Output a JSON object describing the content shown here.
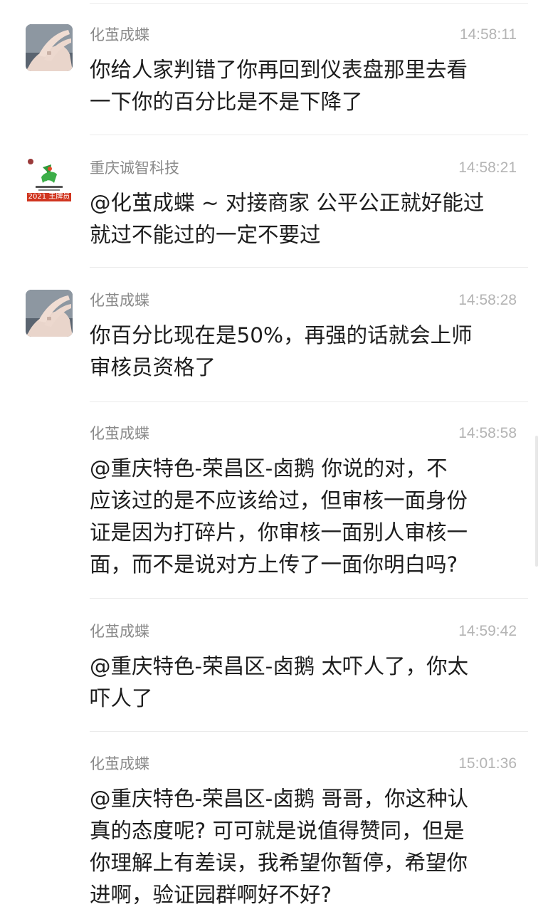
{
  "messages": [
    {
      "sender": "化茧成蝶",
      "time": "14:58:11",
      "text": "你给人家判错了你再回到仪表盘那里去看\n一下你的百分比是不是下降了"
    },
    {
      "sender": "重庆诚智科技",
      "time": "14:58:21",
      "text": "@化茧成蝶 ~ 对接商家 公平公正就好能过\n就过不能过的一定不要过",
      "avatar_badge": "2021 王牌员"
    },
    {
      "sender": "化茧成蝶",
      "time": "14:58:28",
      "text": "你百分比现在是50%，再强的话就会上师\n审核员资格了"
    },
    {
      "sender": "化茧成蝶",
      "time": "14:58:58",
      "text": "@重庆特色-荣昌区-卤鹅 你说的对，不\n应该过的是不应该给过，但审核一面身份\n证是因为打碎片，你审核一面别人审核一\n面，而不是说对方上传了一面你明白吗?"
    },
    {
      "sender": "化茧成蝶",
      "time": "14:59:42",
      "text": "@重庆特色-荣昌区-卤鹅 太吓人了，你太\n吓人了"
    },
    {
      "sender": "化茧成蝶",
      "time": "15:01:36",
      "text": "@重庆特色-荣昌区-卤鹅 哥哥，你这种认\n真的态度呢? 可可就是说值得赞同，但是\n你理解上有差误，我希望你暂停，希望你\n进啊，验证园群啊好不好?"
    }
  ],
  "colors": {
    "sender_name": "#8a8a8a",
    "timestamp": "#b4b4b4",
    "message_text": "#1d1d1d",
    "divider": "#ebebeb",
    "badge_red": "#d0351f",
    "logo_green": "#2e9a3a"
  },
  "icons": {
    "avatar_1": "hand-photo-avatar",
    "avatar_2": "company-logo-avatar"
  }
}
